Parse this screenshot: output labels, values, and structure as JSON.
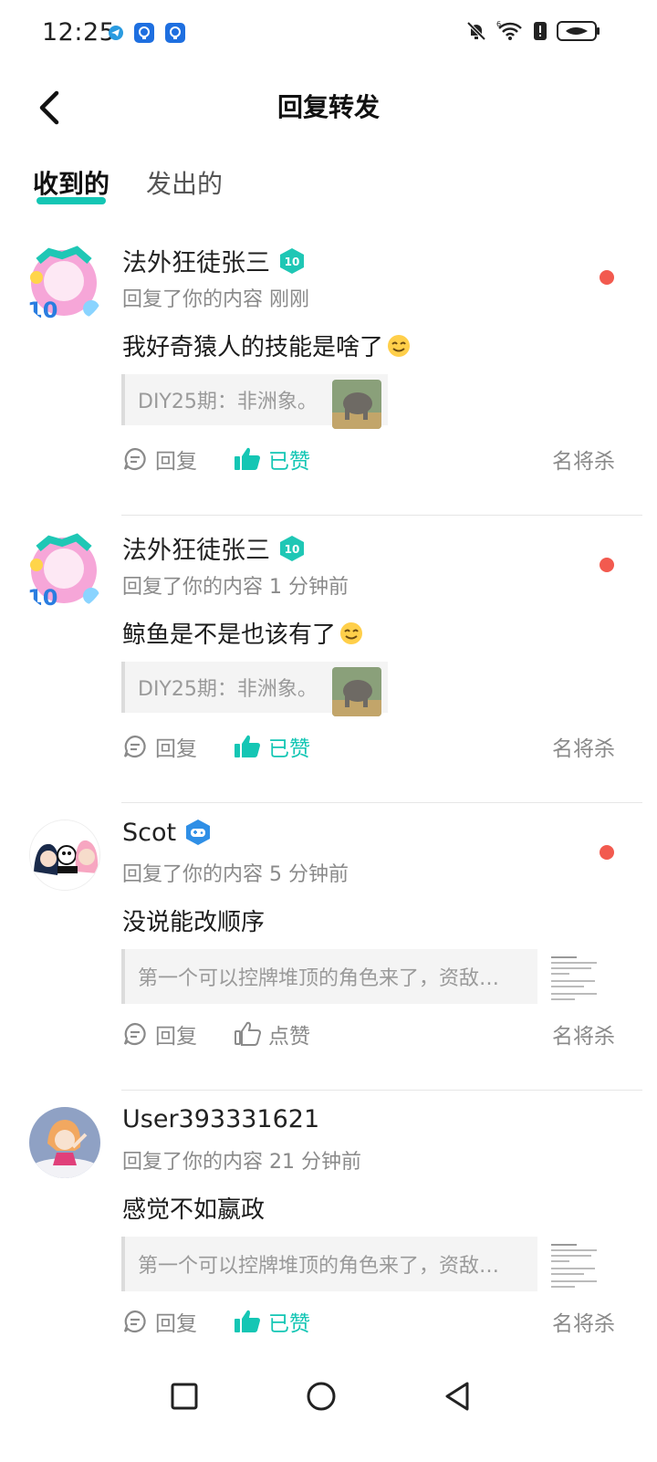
{
  "status_bar": {
    "time": "12:25",
    "network_badge": "6"
  },
  "header": {
    "title": "回复转发"
  },
  "tabs": [
    {
      "label": "收到的",
      "active": true
    },
    {
      "label": "发出的",
      "active": false
    }
  ],
  "actions": {
    "reply": "回复",
    "liked": "已赞",
    "like": "点赞"
  },
  "items": [
    {
      "user": "法外狂徒张三",
      "badge": "10",
      "meta": "回复了你的内容 刚刚",
      "comment": "我好奇猿人的技能是啥了",
      "quote": "DIY25期：非洲象。",
      "liked": true,
      "game": "名将杀",
      "unread": true
    },
    {
      "user": "法外狂徒张三",
      "badge": "10",
      "meta": "回复了你的内容 1 分钟前",
      "comment": "鲸鱼是不是也该有了",
      "quote": "DIY25期：非洲象。",
      "liked": true,
      "game": "名将杀",
      "unread": true
    },
    {
      "user": "Scot",
      "meta": "回复了你的内容 5 分钟前",
      "comment": "没说能改顺序",
      "quote": "第一个可以控牌堆顶的角色来了，资敌…",
      "liked": false,
      "game": "名将杀",
      "unread": true
    },
    {
      "user": "User393331621",
      "meta": "回复了你的内容 21 分钟前",
      "comment": "感觉不如嬴政",
      "quote": "第一个可以控牌堆顶的角色来了，资敌…",
      "liked": true,
      "game": "名将杀",
      "unread": false
    }
  ],
  "colors": {
    "accent": "#14c6b4",
    "unread_dot": "#f25a4f"
  }
}
